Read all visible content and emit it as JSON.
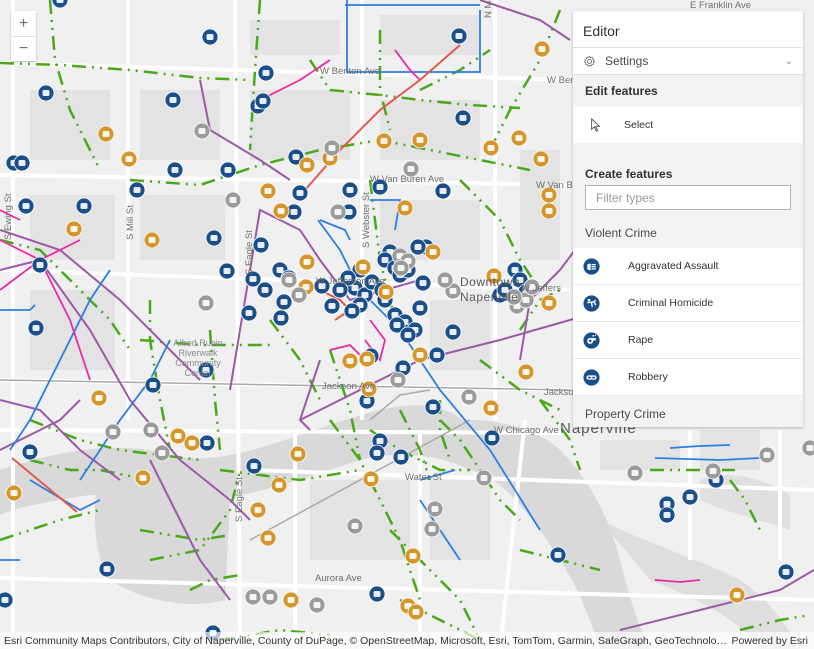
{
  "map": {
    "zoom_in_label": "+",
    "zoom_out_label": "−",
    "city_label": "Naperville",
    "downtown_label_line1": "Downtown",
    "downtown_label_line2": "Naperville",
    "poi_label": [
      "Alfred Rubin",
      "Riverwalk",
      "Community",
      "Center"
    ],
    "street_labels": {
      "franklin": "E Franklin Ave",
      "benton": "W Benton Ave",
      "benton_e": "W Benton",
      "van_buren": "W Van Buren Ave",
      "van_buren_e": "W Van Bur",
      "jefferson": "W Jefferson Ave",
      "jefferson_e": "W Jeffers",
      "jackson": "Jackson Ave",
      "jackson_e": "Jackson",
      "chicago": "W Chicago Ave",
      "water": "Water St",
      "aurora": "Aurora Ave",
      "main": "N Main St",
      "webster": "S Webster St",
      "eagle": "S Eagle St",
      "eagle_2": "S Eagle St",
      "mill": "S Mill St",
      "ewing": "S Ewing St"
    },
    "colors": {
      "violent_blue": "#1b4f8a",
      "property_orange": "#d6962e",
      "other_gray": "#9b9b9b",
      "line_green": "#4aa81b",
      "line_purple": "#9b59a6",
      "line_blue": "#2e7de1",
      "line_magenta": "#e82aa8",
      "line_red": "#e35a4a"
    }
  },
  "attribution": {
    "text": "Esri Community Maps Contributors, City of Naperville, County of DuPage, © OpenStreetMap, Microsoft, Esri, TomTom, Garmin, SafeGraph, GeoTechnologies, Inc, METI/NASA, ...",
    "powered_by": "Powered by Esri"
  },
  "editor": {
    "title": "Editor",
    "settings_label": "Settings",
    "edit_features_heading": "Edit features",
    "select_label": "Select",
    "create_features_heading": "Create features",
    "filter_placeholder": "Filter types",
    "filter_value": "",
    "groups": [
      {
        "name": "Violent Crime",
        "types": [
          {
            "label": "Aggravated Assault",
            "icon": "aggravated-assault-icon"
          },
          {
            "label": "Criminal Homicide",
            "icon": "criminal-homicide-icon"
          },
          {
            "label": "Rape",
            "icon": "rape-icon"
          },
          {
            "label": "Robbery",
            "icon": "robbery-icon"
          }
        ]
      },
      {
        "name": "Property Crime",
        "types": []
      }
    ]
  }
}
